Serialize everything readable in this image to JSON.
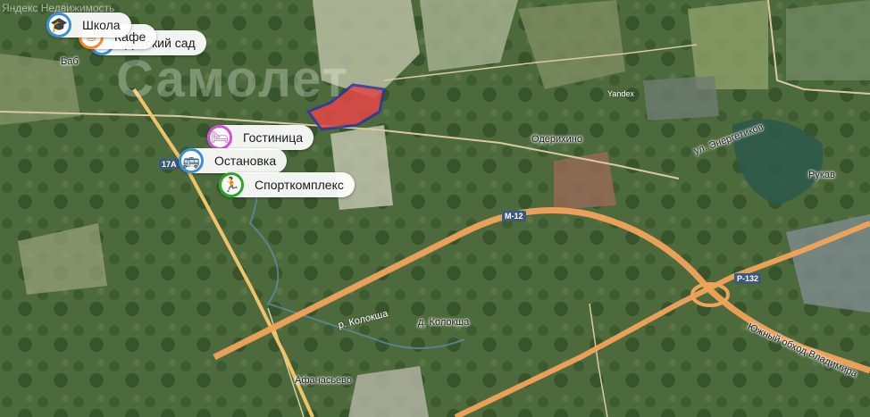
{
  "branding": {
    "logo_text": "Яндекс Недвижимость",
    "watermark": "Самолет"
  },
  "map_labels": {
    "odherikhino": "Одерихино",
    "rukav": "Рукав",
    "koloksha_village": "д. Колокша",
    "afanasevo": "Афанасьево",
    "river": "р. Колокша",
    "energetikov": "ул. Энергетиков",
    "yuzhny_obkhod": "Южный обход Владимира",
    "yandex": "Yandex",
    "babaevo": "Баб"
  },
  "road_shields": {
    "m12": "М-12",
    "r132": "Р-132",
    "a17": "17А"
  },
  "pois": [
    {
      "key": "school",
      "label": "Школа",
      "color": "#3a8fd6",
      "icon": "graduation-cap-icon"
    },
    {
      "key": "cafe",
      "label": "Кафе",
      "color": "#f08a24",
      "icon": "cup-icon"
    },
    {
      "key": "kindergarten",
      "label": "Детский сад",
      "color": "#3a8fd6",
      "icon": "child-icon"
    },
    {
      "key": "bus_stop_top",
      "label": "Остановка",
      "color": "#3a8fd6",
      "icon": "bus-icon"
    },
    {
      "key": "hotel",
      "label": "Гостиница",
      "color": "#d24fd2",
      "icon": "bed-icon"
    },
    {
      "key": "bus_stop",
      "label": "Остановка",
      "color": "#3a8fd6",
      "icon": "bus-icon"
    },
    {
      "key": "sport",
      "label": "Спорткомплекс",
      "color": "#2aa52a",
      "icon": "runner-icon"
    }
  ],
  "colors": {
    "road_federal": "#f2a35a",
    "parcel": "#e64646",
    "parcel_border": "#2d3a9a"
  }
}
